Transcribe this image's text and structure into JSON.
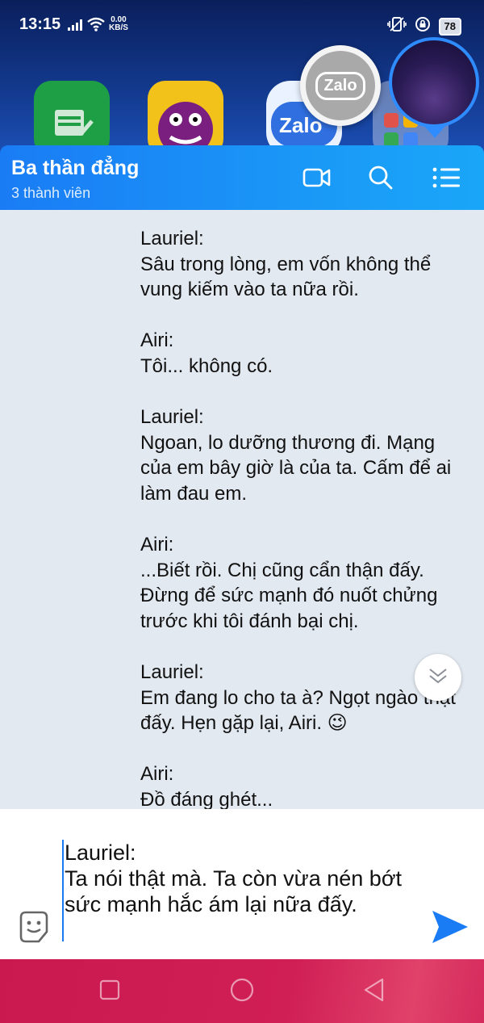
{
  "status_bar": {
    "time": "13:15",
    "net_speed_value": "0.00",
    "net_speed_unit": "KB/S",
    "battery": "78"
  },
  "home": {
    "zalo_bubble_label": "Zalo",
    "zalo_app_label": "Zalo"
  },
  "chat": {
    "title": "Ba thần đẳng",
    "subtitle": "3 thành viên",
    "message_text": "Lauriel:\nSâu trong lòng, em vốn không thể vung kiếm vào ta nữa rồi.\n\nAiri:\nTôi... không có.\n\nLauriel:\nNgoan, lo dưỡng thương đi. Mạng của em bây giờ là của ta. Cấm để ai làm đau em.\n\nAiri:\n...Biết rồi. Chị cũng cẩn thận đấy. Đừng để sức mạnh đó nuốt chửng trước khi tôi đánh bại chị.\n\nLauriel:\nEm đang lo cho ta à? Ngọt ngào thật đấy. Hẹn gặp lại, Airi. 😉\n\nAiri:\nĐồ đáng ghét..."
  },
  "composer": {
    "draft_text": "Lauriel:\nTa nói thật mà. Ta còn vừa nén bớt sức mạnh hắc ám lại nữa đấy."
  },
  "colors": {
    "header_blue": "#1a7cf5",
    "chat_bg": "#e3e9f1",
    "send_blue": "#1a7cf5",
    "nav_bar": "#c9194f"
  },
  "icons": [
    "signal-icon",
    "wifi-icon",
    "video-call-icon",
    "search-icon",
    "menu-list-icon",
    "chevron-double-down-icon",
    "sticker-icon",
    "send-icon",
    "recents-icon",
    "home-icon",
    "back-icon"
  ]
}
